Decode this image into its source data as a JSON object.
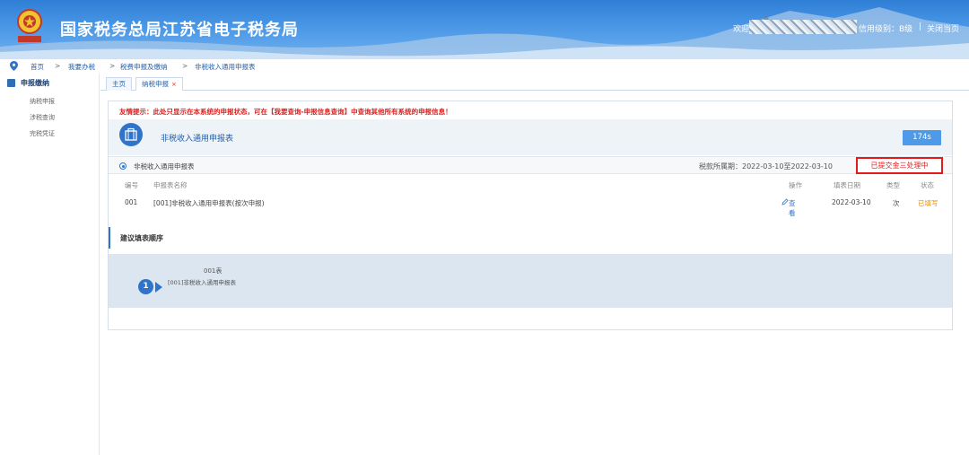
{
  "header": {
    "site_title": "国家税务总局江苏省电子税务局",
    "emblem_text": "中国税务",
    "welcome": "欢迎",
    "credit_level": "信用级别：B级",
    "separator": "|",
    "close_page": "关闭当页"
  },
  "breadcrumb": [
    "首页",
    "我要办税",
    "税费申报及缴纳",
    "非税收入通用申报表"
  ],
  "breadcrumb_sep": ">",
  "sidebar": {
    "heading": "申报缴纳",
    "items": [
      "纳税申报",
      "涉税查询",
      "完税凭证"
    ]
  },
  "tabs": [
    {
      "label": "主页",
      "closable": false
    },
    {
      "label": "纳税申报",
      "closable": true,
      "close_symbol": "×"
    }
  ],
  "notice": "友情提示：此处只显示在本系统的申报状态，可在【我要查询-申报信息查询】中查询其他所有系统的申报信息！",
  "form": {
    "title": "非税收入通用申报表",
    "timer": "174s"
  },
  "selection": {
    "label": "非税收入通用申报表",
    "period": "税款所属期：2022-03-10至2022-03-10",
    "status": "已提交金三处理中"
  },
  "table": {
    "headers": [
      "编号",
      "申报表名称",
      "操作",
      "填表日期",
      "类型",
      "状态"
    ],
    "rows": [
      {
        "id": "001",
        "name": "[001]非税收入通用申报表(按次申报)",
        "action": "查看",
        "date": "2022-03-10",
        "type": "次",
        "status": "已填写"
      }
    ]
  },
  "fill_order": {
    "heading": "建议填表顺序",
    "steps": [
      {
        "number": "1",
        "code": "001表",
        "name": "[001]非税收入通用申报表"
      }
    ]
  },
  "colors": {
    "accent": "#2f74c9",
    "alert": "#e51a1a",
    "filled": "#e6900e"
  }
}
